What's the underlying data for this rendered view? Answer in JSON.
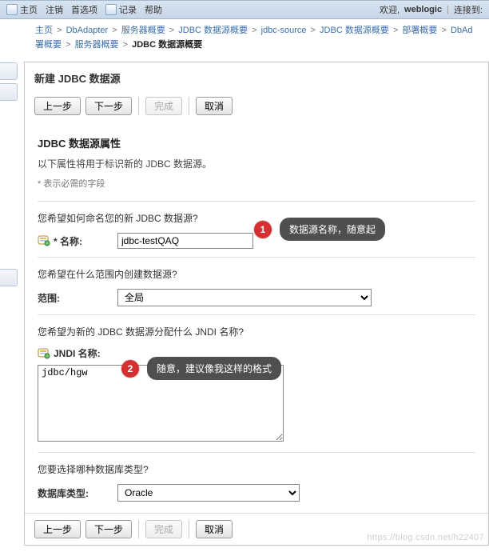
{
  "nav": {
    "home": "主页",
    "logout": "注销",
    "prefs": "首选项",
    "record": "记录",
    "help": "帮助",
    "welcome": "欢迎,",
    "user": "weblogic",
    "connected": "连接到:"
  },
  "breadcrumbs": {
    "items": [
      "主页",
      "DbAdapter",
      "服务器概要",
      "JDBC 数据源概要",
      "jdbc-source",
      "JDBC 数据源概要",
      "部署概要",
      "DbAd"
    ],
    "line2_items": [
      "署概要",
      "服务器概要"
    ],
    "current": "JDBC 数据源概要"
  },
  "panel": {
    "title": "新建 JDBC 数据源"
  },
  "buttons": {
    "back": "上一步",
    "next": "下一步",
    "finish": "完成",
    "cancel": "取消"
  },
  "form": {
    "section_heading": "JDBC 数据源属性",
    "section_desc": "以下属性将用于标识新的 JDBC 数据源。",
    "required_hint": "* 表示必需的字段",
    "q_name": "您希望如何命名您的新 JDBC 数据源?",
    "name_label": "* 名称:",
    "name_value": "jdbc-testQAQ",
    "q_scope": "您希望在什么范围内创建数据源?",
    "scope_label": "范围:",
    "scope_value": "全局",
    "q_jndi": "您希望为新的 JDBC 数据源分配什么 JNDI 名称?",
    "jndi_label": "JNDI 名称:",
    "jndi_value": "jdbc/hgw",
    "q_dbtype": "您要选择哪种数据库类型?",
    "dbtype_label": "数据库类型:",
    "dbtype_value": "Oracle"
  },
  "annotations": {
    "a1": {
      "num": "1",
      "text": "数据源名称，随意起"
    },
    "a2": {
      "num": "2",
      "text": "随意，建议像我这样的格式"
    }
  },
  "watermark": "https://blog.csdn.net/h22407"
}
